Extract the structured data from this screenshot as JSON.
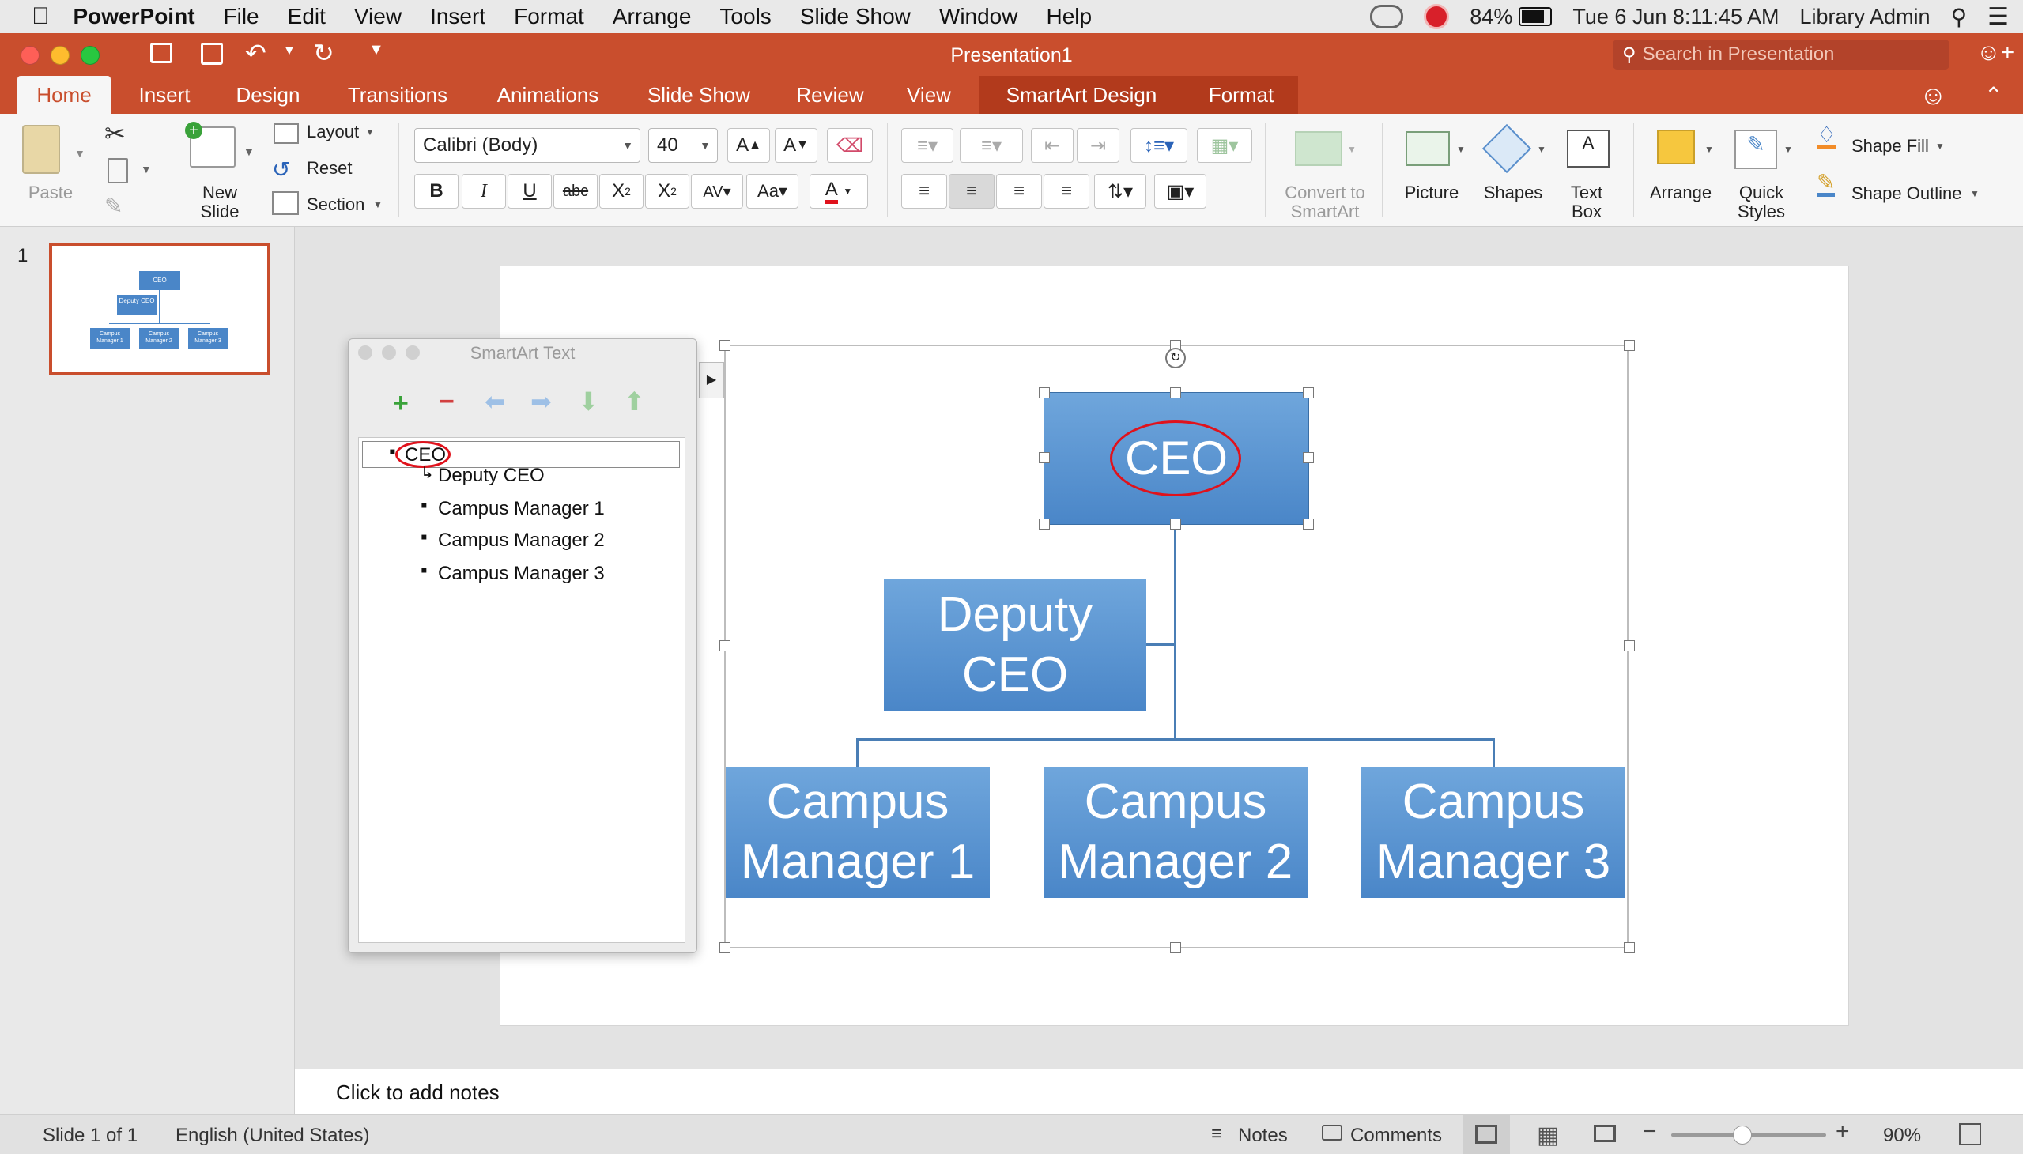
{
  "menubar": {
    "app": "PowerPoint",
    "items": [
      "File",
      "Edit",
      "View",
      "Insert",
      "Format",
      "Arrange",
      "Tools",
      "Slide Show",
      "Window",
      "Help"
    ],
    "battery": "84%",
    "datetime": "Tue 6 Jun  8:11:45 AM",
    "user": "Library Admin"
  },
  "window": {
    "title": "Presentation1",
    "search_placeholder": "Search in Presentation"
  },
  "tabs": [
    "Home",
    "Insert",
    "Design",
    "Transitions",
    "Animations",
    "Slide Show",
    "Review",
    "View",
    "SmartArt Design",
    "Format"
  ],
  "ribbon": {
    "paste": "Paste",
    "new_slide": "New\nSlide",
    "layout": "Layout",
    "reset": "Reset",
    "section": "Section",
    "font_name": "Calibri (Body)",
    "font_size": "40",
    "convert": "Convert to\nSmartArt",
    "picture": "Picture",
    "shapes": "Shapes",
    "text_box": "Text\nBox",
    "arrange": "Arrange",
    "quick_styles": "Quick\nStyles",
    "shape_fill": "Shape Fill",
    "shape_outline": "Shape Outline"
  },
  "thumbnail": {
    "number": "1",
    "ceo": "CEO",
    "deputy": "Deputy CEO",
    "managers": [
      "Campus Manager 1",
      "Campus Manager 2",
      "Campus Manager 3"
    ]
  },
  "smartart_pane": {
    "title": "SmartArt Text",
    "items": [
      "CEO",
      "Deputy CEO",
      "Campus Manager 1",
      "Campus Manager 2",
      "Campus Manager 3"
    ]
  },
  "slide": {
    "ceo": "CEO",
    "deputy_line1": "Deputy",
    "deputy_line2": "CEO",
    "managers": [
      {
        "line1": "Campus",
        "line2": "Manager 1"
      },
      {
        "line1": "Campus",
        "line2": "Manager 2"
      },
      {
        "line1": "Campus",
        "line2": "Manager 3"
      }
    ]
  },
  "notes_placeholder": "Click to add notes",
  "status": {
    "slide": "Slide 1 of 1",
    "language": "English (United States)",
    "notes": "Notes",
    "comments": "Comments",
    "zoom": "90%"
  },
  "colors": {
    "accent": "#c94e2d",
    "box": "#4a86c8",
    "highlight": "#e0121c"
  }
}
